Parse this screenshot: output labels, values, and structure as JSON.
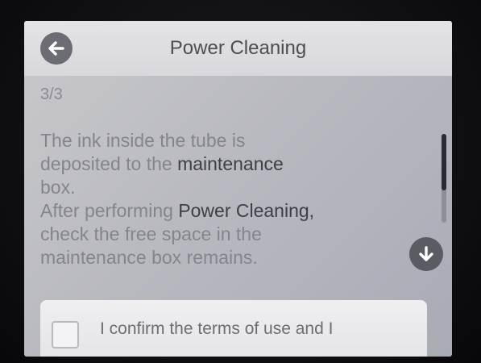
{
  "header": {
    "title": "Power Cleaning",
    "back_icon": "arrow-left-icon"
  },
  "step_indicator": "3/3",
  "message": {
    "line1": "The ink inside the tube is",
    "line2_a": "deposited to the ",
    "line2_b": "maintenance",
    "line3": "box.",
    "line4_a": "After performing ",
    "line4_b": "Power Cleaning,",
    "line5_a": "check the free space in the",
    "line6_a": "maintenance box remains."
  },
  "scroll_down_icon": "arrow-down-icon",
  "confirm": {
    "label": "I confirm the terms of use and I",
    "checked": false
  },
  "colors": {
    "screen_bg": "#b9bac0",
    "titlebar_bg": "#e4e3e6",
    "button_bg": "#6c6d74"
  }
}
